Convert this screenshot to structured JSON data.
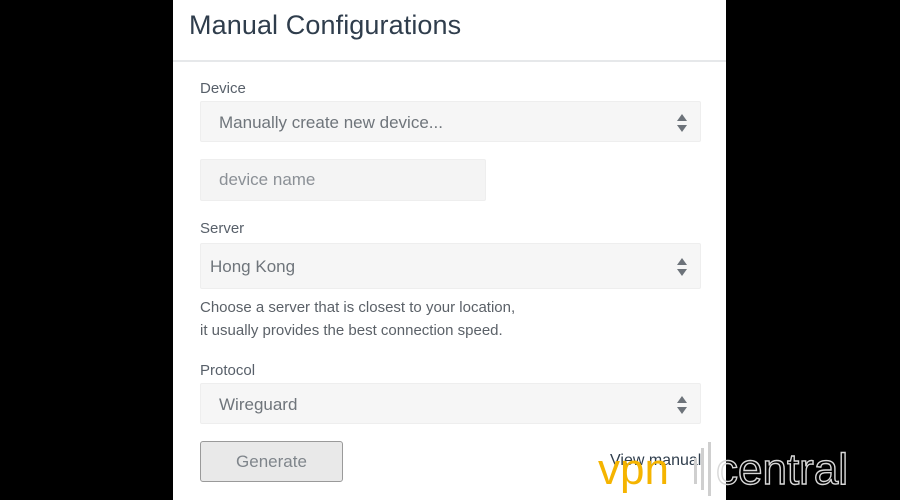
{
  "header": {
    "title": "Manual Configurations"
  },
  "device": {
    "label": "Device",
    "selected": "Manually create new device...",
    "name_placeholder": "device name"
  },
  "server": {
    "label": "Server",
    "selected": "Hong Kong",
    "hint_line1": "Choose a server that is closest to your location,",
    "hint_line2": "it usually provides the best connection speed."
  },
  "protocol": {
    "label": "Protocol",
    "selected": "Wireguard"
  },
  "actions": {
    "generate_label": "Generate",
    "view_manual_label": "View manual"
  },
  "watermark": {
    "brand_vpn": "vpn",
    "brand_central": "central",
    "brand_color": "#f5b400"
  },
  "icons": {
    "select_arrows": "sort-updown-icon"
  }
}
